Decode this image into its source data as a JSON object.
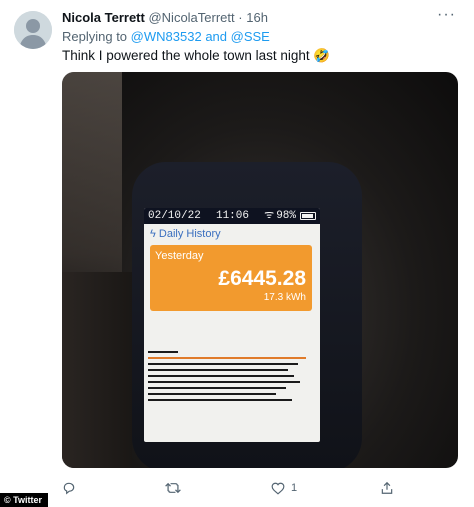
{
  "tweet": {
    "author_name": "Nicola Terrett",
    "author_handle": "@NicolaTerrett",
    "separator": "·",
    "time": "16h",
    "replying_prefix": "Replying to",
    "mention_1": "@WN83532",
    "mention_joiner": "and",
    "mention_2": "@SSE",
    "text": "Think I powered the whole town last night 🤣",
    "more_icon": "more-icon"
  },
  "meter": {
    "date": "02/10/22",
    "clock": "11:06",
    "battery": "98%",
    "title": "Daily History",
    "card_label": "Yesterday",
    "amount": "£6445.28",
    "energy": "17.3 kWh",
    "accent_color": "#f29a2e",
    "title_color": "#3a6fbf"
  },
  "actions": {
    "reply_icon": "reply-icon",
    "retweet_icon": "retweet-icon",
    "like_icon": "like-icon",
    "like_count": "1",
    "share_icon": "share-icon"
  },
  "credit": "© Twitter",
  "colors": {
    "link": "#1d9bf0",
    "secondary_text": "#536471"
  }
}
